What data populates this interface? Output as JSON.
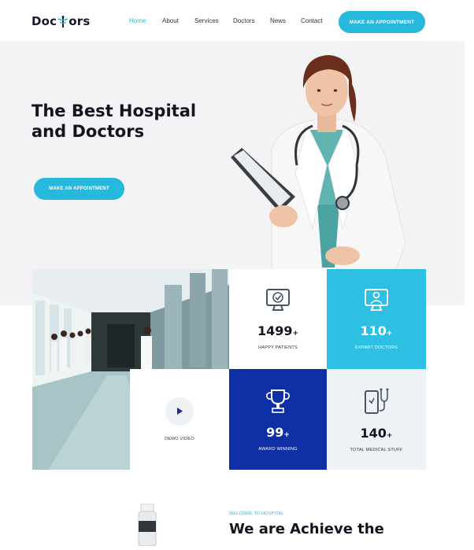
{
  "header": {
    "logo_prefix": "Doc",
    "logo_suffix": "ors",
    "nav": [
      {
        "label": "Home",
        "active": true
      },
      {
        "label": "About",
        "active": false
      },
      {
        "label": "Services",
        "active": false
      },
      {
        "label": "Doctors",
        "active": false
      },
      {
        "label": "News",
        "active": false
      },
      {
        "label": "Contact",
        "active": false
      }
    ],
    "cta_label": "MAKE AN APPOINTMENT"
  },
  "hero": {
    "title_line1": "The Best Hospital",
    "title_line2": "and Doctors",
    "cta_label": "MAKE AN APPOINTMENT"
  },
  "stats": [
    {
      "value": "1499",
      "suffix": "+",
      "label": "HAPPY PATIENTS",
      "icon": "monitor-check-icon"
    },
    {
      "value": "110",
      "suffix": "+",
      "label": "EXPART DOCTORS",
      "icon": "doctor-screen-icon"
    },
    {
      "value": "99",
      "suffix": "+",
      "label": "AWARD WINNING",
      "icon": "trophy-icon"
    },
    {
      "value": "140",
      "suffix": "+",
      "label": "TOTAL MEDICAL STUFF",
      "icon": "phone-stethoscope-icon"
    }
  ],
  "video": {
    "label": "DEMO VIDEO",
    "icon": "play-icon"
  },
  "about": {
    "kicker": "WELCOME TO HOSPITAL",
    "title": "We are Achieve the"
  },
  "colors": {
    "accent": "#27b8de",
    "navy": "#0f2fa6",
    "cyan_tile": "#2ec0e3",
    "hero_bg": "#f3f3f5",
    "text_dark": "#141420"
  }
}
